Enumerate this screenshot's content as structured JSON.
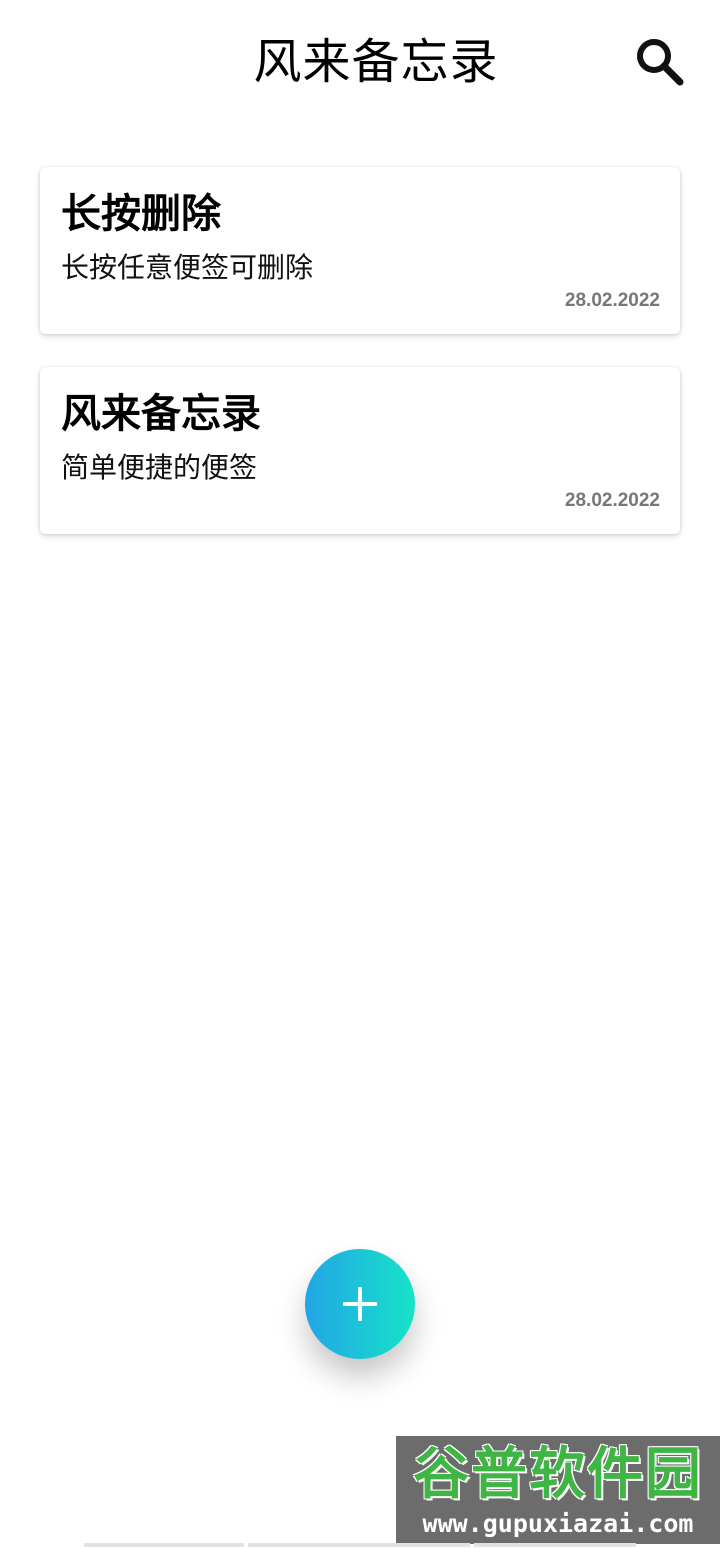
{
  "header": {
    "title": "风来备忘录",
    "search_icon": "search-icon"
  },
  "notes": [
    {
      "title": "长按删除",
      "body": "长按任意便签可删除",
      "date": "28.02.2022"
    },
    {
      "title": "风来备忘录",
      "body": "简单便捷的便签",
      "date": "28.02.2022"
    }
  ],
  "fab": {
    "icon": "plus-icon",
    "gradient_start": "#22a5e6",
    "gradient_end": "#17e3c8"
  },
  "watermark": {
    "brand": "谷普软件园",
    "url": "www.gupuxiazai.com"
  }
}
